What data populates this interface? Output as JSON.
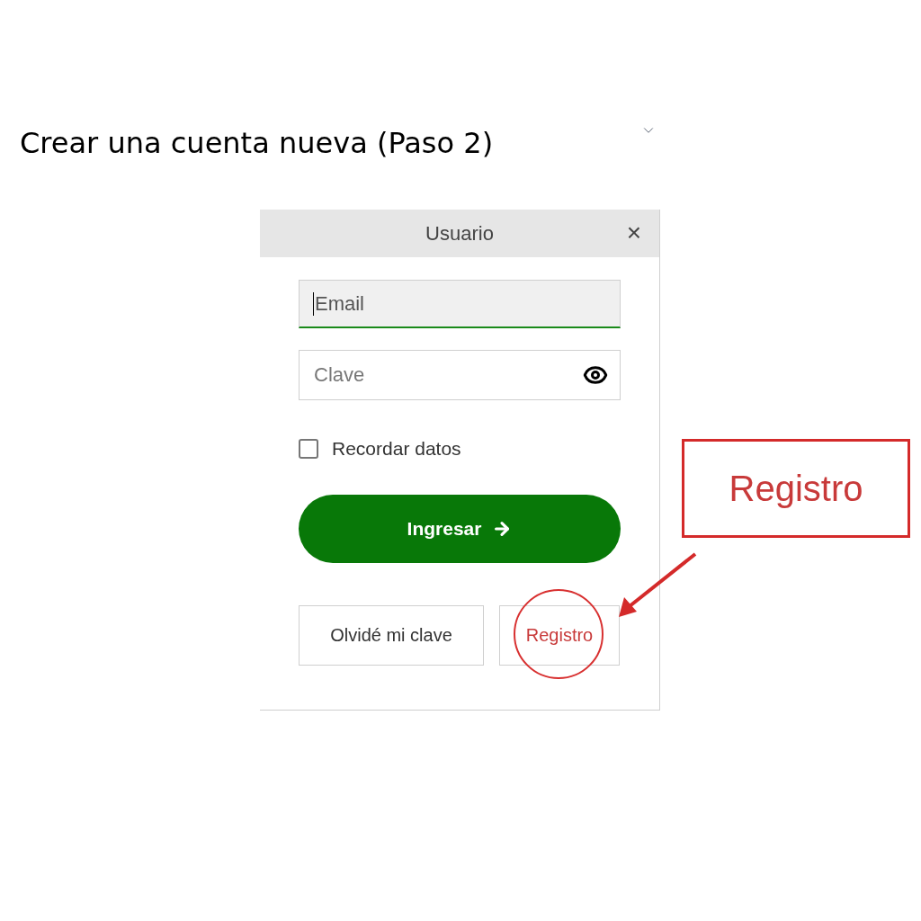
{
  "page": {
    "title": "Crear una cuenta nueva (Paso 2)",
    "expanded": false
  },
  "dialog": {
    "title": "Usuario",
    "close": "×",
    "email": {
      "placeholder": "Email",
      "focused": true
    },
    "password": {
      "placeholder": "Clave"
    },
    "remember": {
      "label": "Recordar datos",
      "checked": false
    },
    "login_button": "Ingresar",
    "buttons": [
      {
        "label": "Olvidé mi clave",
        "highlighted": false
      },
      {
        "label": "Registro",
        "highlighted": true
      }
    ]
  },
  "callout": {
    "label": "Registro"
  }
}
